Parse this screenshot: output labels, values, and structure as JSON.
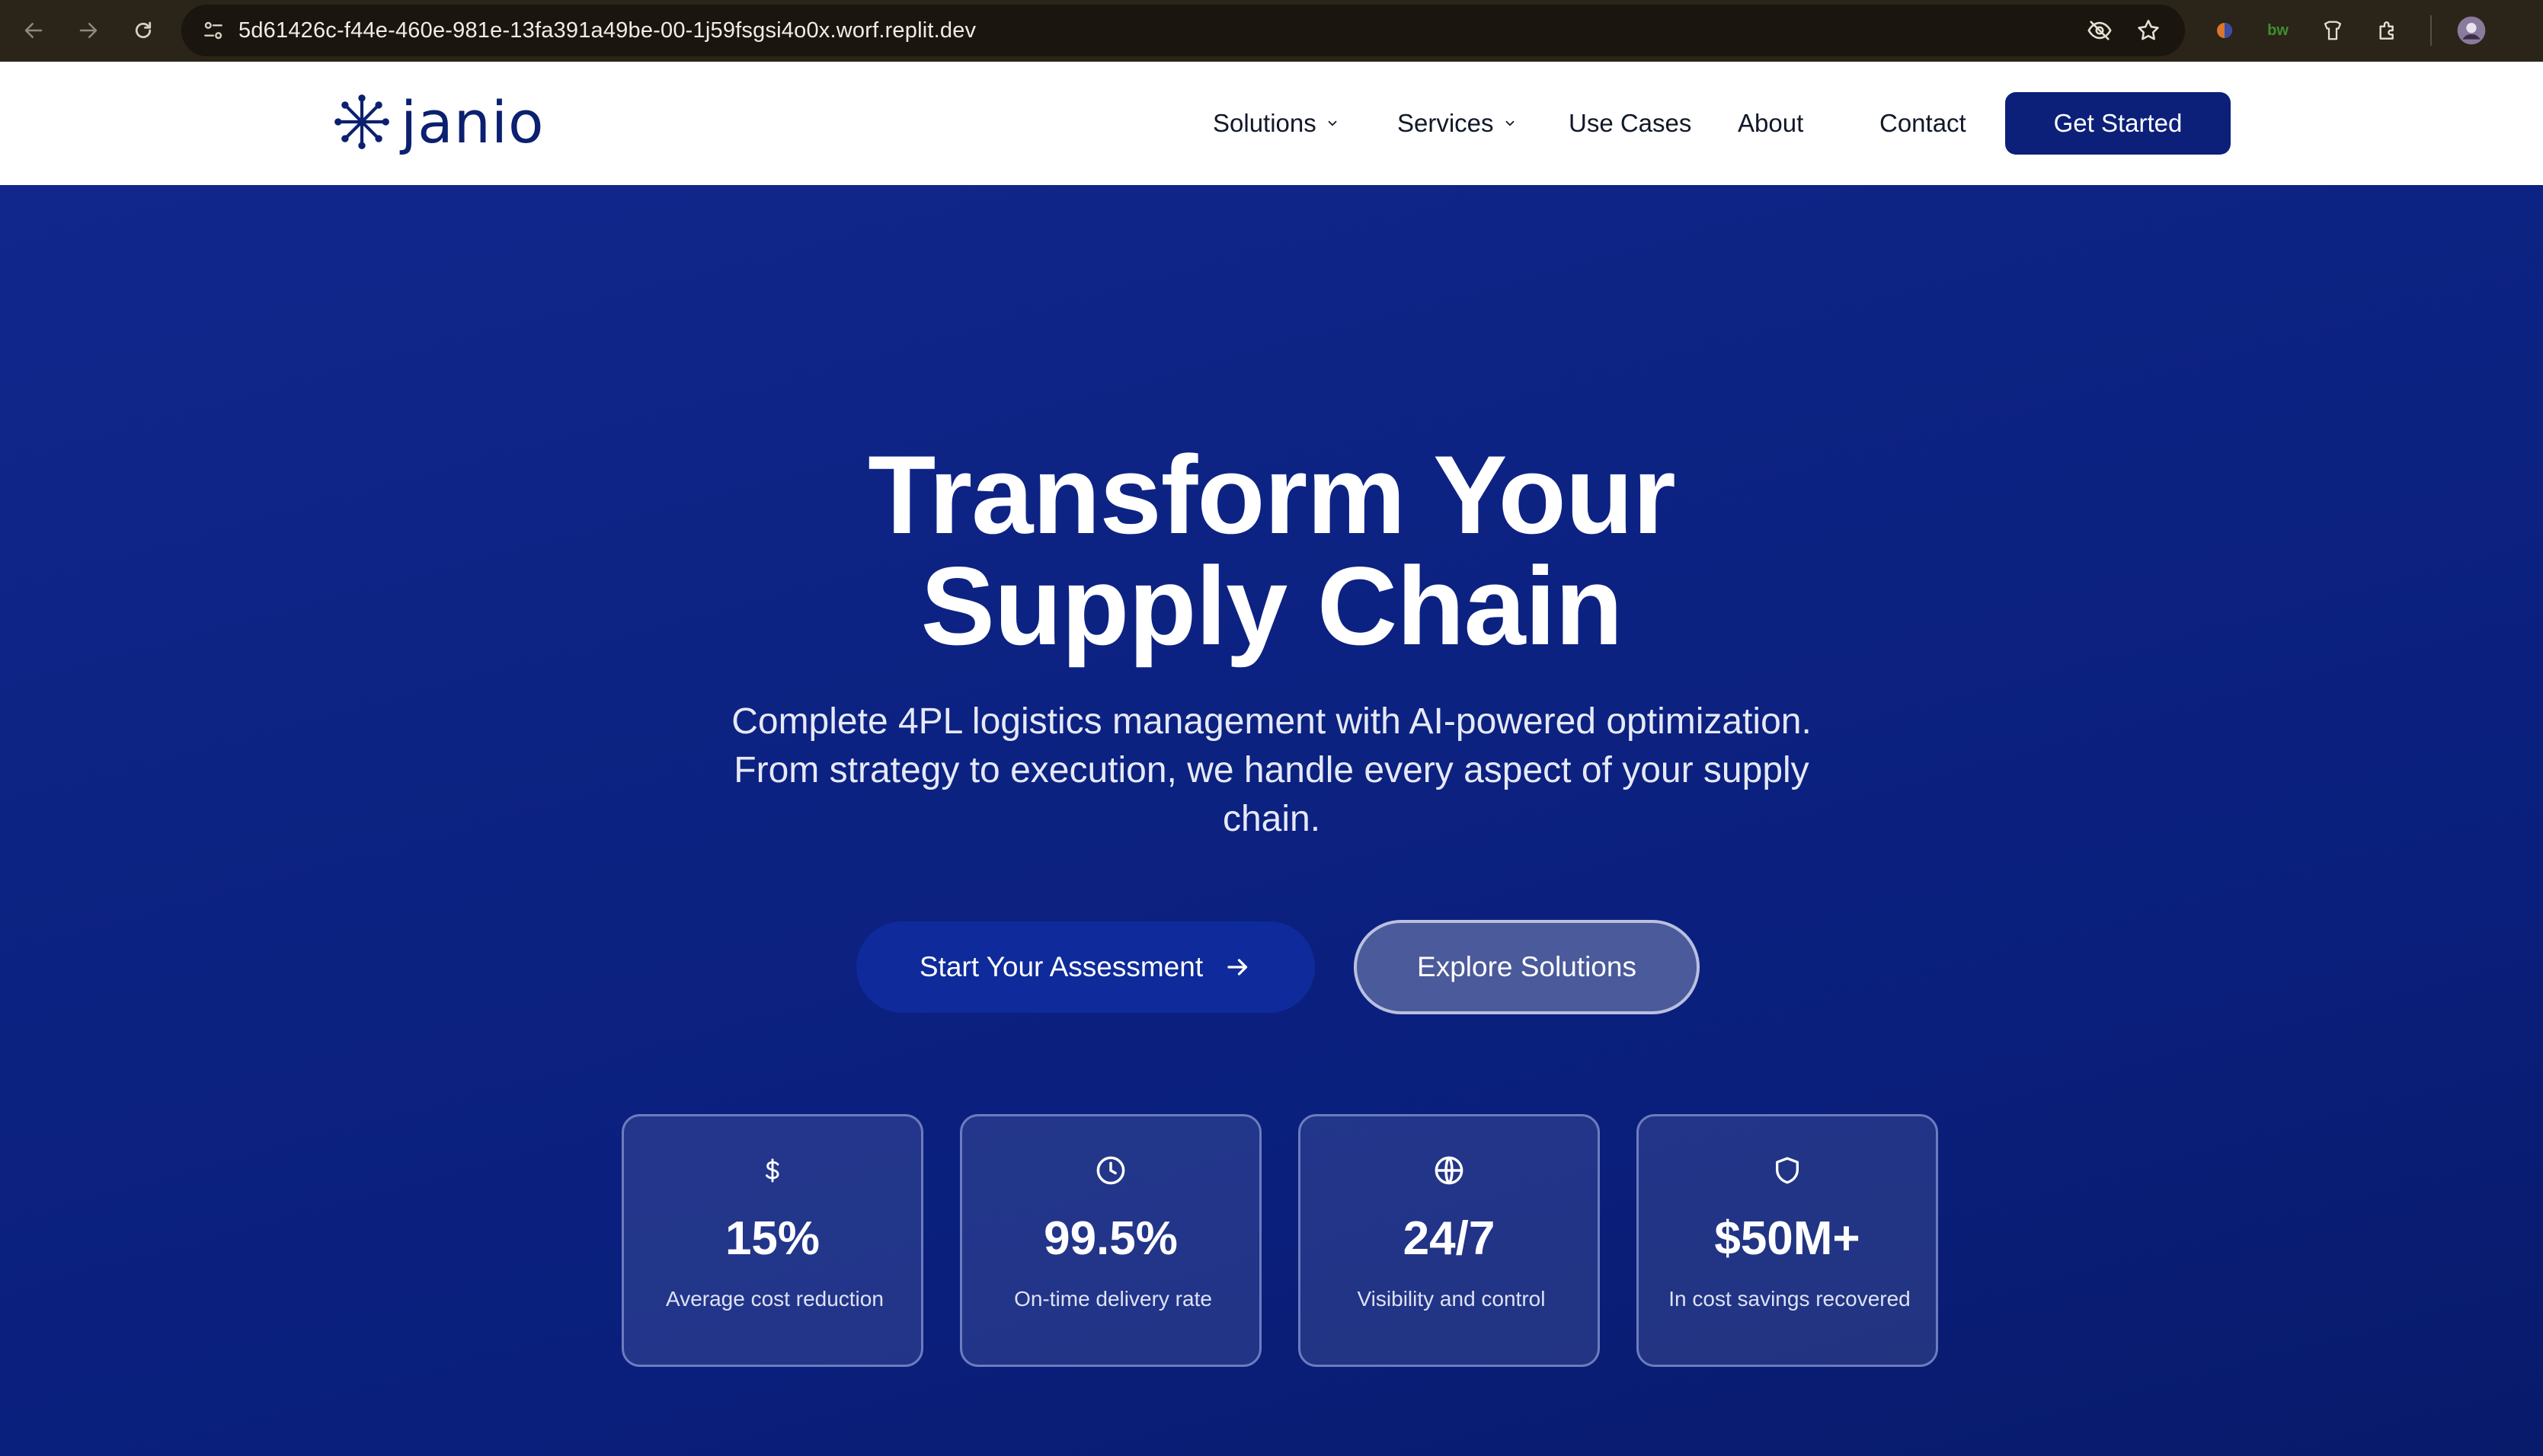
{
  "browser": {
    "url": "5d61426c-f44e-460e-981e-13fa391a49be-00-1j59fsgsi4o0x.worf.replit.dev",
    "icons": [
      "back-icon",
      "forward-icon",
      "reload-icon",
      "site-info-icon",
      "eye-off-icon",
      "star-icon",
      "extension-icon",
      "extension-icon",
      "extension-icon",
      "puzzle-icon",
      "profile-avatar"
    ]
  },
  "header": {
    "logo_text": "janio",
    "menu": {
      "solutions": "Solutions",
      "services": "Services",
      "use_cases": "Use Cases",
      "about": "About",
      "contact": "Contact"
    },
    "cta": "Get Started"
  },
  "hero": {
    "title_line1": "Transform Your",
    "title_line2": "Supply Chain",
    "subtitle": "Complete 4PL logistics management with AI-powered optimization. From strategy to execution, we handle every aspect of your supply chain.",
    "primary_button": "Start Your Assessment",
    "secondary_button": "Explore Solutions"
  },
  "stats": [
    {
      "icon": "dollar-icon",
      "value": "15%",
      "label": "Average cost reduction"
    },
    {
      "icon": "clock-icon",
      "value": "99.5%",
      "label": "On-time delivery rate"
    },
    {
      "icon": "globe-icon",
      "value": "24/7",
      "label": "Visibility and control"
    },
    {
      "icon": "shield-icon",
      "value": "$50M+",
      "label": "In cost savings recovered"
    }
  ],
  "colors": {
    "brand_navy": "#0c2070",
    "hero_bg": "#0d2383",
    "cta_bg": "#0c2079"
  }
}
